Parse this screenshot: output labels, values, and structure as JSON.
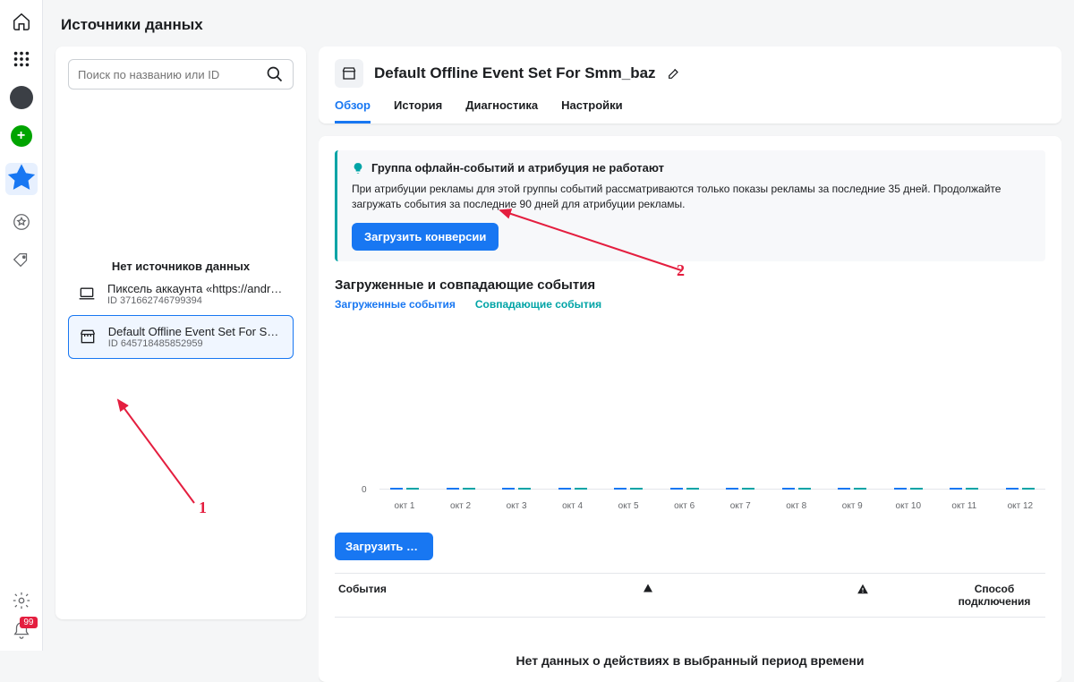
{
  "page_title": "Источники данных",
  "search": {
    "placeholder": "Поиск по названию или ID"
  },
  "left": {
    "no_sources_label": "Нет источников данных",
    "item1_title": "Пиксель аккаунта «https://andrey…",
    "item1_sub": "ID 371662746799394",
    "item2_title": "Default Offline Event Set For Smm_…",
    "item2_sub": "ID 645718485852959"
  },
  "header": {
    "title": "Default Offline Event Set For Smm_baz"
  },
  "tabs": {
    "t1": "Обзор",
    "t2": "История",
    "t3": "Диагностика",
    "t4": "Настройки"
  },
  "alert": {
    "title": "Группа офлайн-событий и атрибуция не работают",
    "body": "При атрибуции рекламы для этой группы событий рассматриваются только показы рекламы за последние 35 дней. Продолжайте загружать события за последние 90 дней для атрибуции рекламы.",
    "button": "Загрузить конверсии"
  },
  "events": {
    "section_title": "Загруженные и совпадающие события",
    "legend_uploaded": "Загруженные события",
    "legend_matched": "Совпадающие события"
  },
  "chart_data": {
    "type": "line",
    "title": "",
    "xlabel": "",
    "ylabel": "",
    "ylim": [
      0,
      1
    ],
    "categories": [
      "окт 1",
      "окт 2",
      "окт 3",
      "окт 4",
      "окт 5",
      "окт 6",
      "окт 7",
      "окт 8",
      "окт 9",
      "окт 10",
      "окт 11",
      "окт 12"
    ],
    "series": [
      {
        "name": "Загруженные события",
        "values": [
          0,
          0,
          0,
          0,
          0,
          0,
          0,
          0,
          0,
          0,
          0,
          0
        ]
      },
      {
        "name": "Совпадающие события",
        "values": [
          0,
          0,
          0,
          0,
          0,
          0,
          0,
          0,
          0,
          0,
          0,
          0
        ]
      }
    ],
    "zero_label": "0"
  },
  "upload_btn": "Загрузить с…",
  "table": {
    "col1": "События",
    "col4": "Способ подключения"
  },
  "footer": "Нет данных о действиях в выбранный период времени",
  "anno": {
    "n1": "1",
    "n2": "2"
  },
  "badge": "99"
}
